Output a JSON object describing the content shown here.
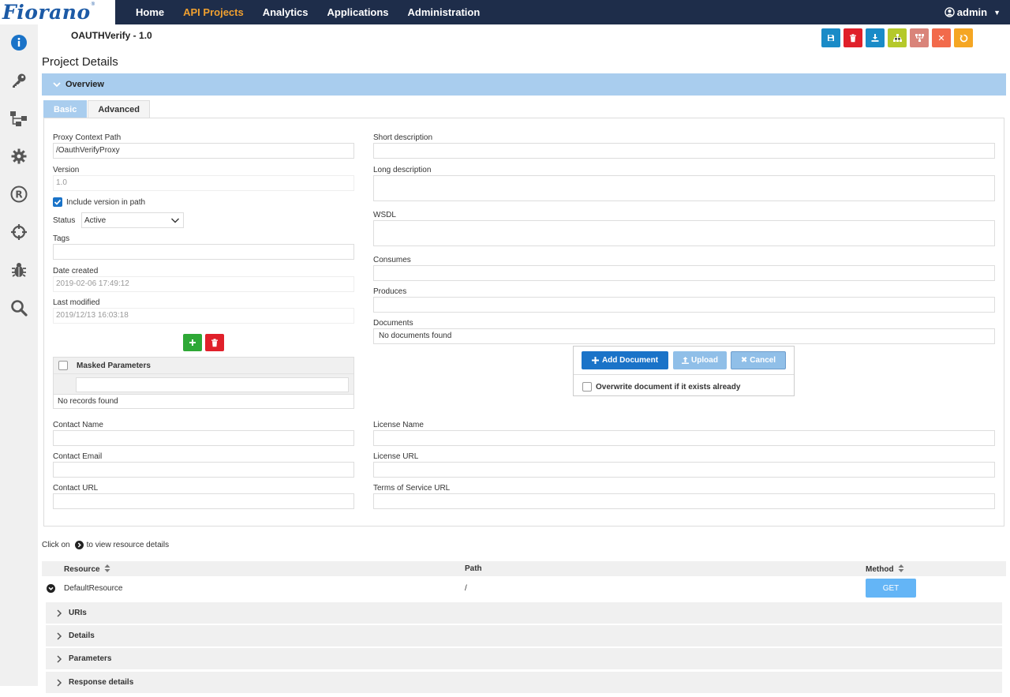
{
  "header": {
    "logo_text": "Fiorano",
    "nav": [
      "Home",
      "API Projects",
      "Analytics",
      "Applications",
      "Administration"
    ],
    "active_nav": "API Projects",
    "user": "admin"
  },
  "sidebar": {
    "icons": [
      "info-icon",
      "key-icon",
      "flow-icon",
      "gear-icon",
      "registered-icon",
      "crosshair-icon",
      "bug-icon",
      "search-icon"
    ]
  },
  "project": {
    "title": "OAUTHVerify - 1.0",
    "page_title": "Project Details"
  },
  "toolbar": {
    "buttons": [
      {
        "name": "save",
        "color": "#1a8bc7"
      },
      {
        "name": "delete",
        "color": "#e0202a"
      },
      {
        "name": "download",
        "color": "#1a8bc7"
      },
      {
        "name": "hierarchy",
        "color": "#b5c92a"
      },
      {
        "name": "tree",
        "color": "#d9847a"
      },
      {
        "name": "close",
        "color": "#f26a4b"
      },
      {
        "name": "refresh",
        "color": "#f5a623"
      }
    ]
  },
  "overview": {
    "label": "Overview",
    "tabs": [
      "Basic",
      "Advanced"
    ],
    "active_tab": "Basic"
  },
  "form": {
    "proxy_context_path_label": "Proxy Context Path",
    "proxy_context_path_value": "/OauthVerifyProxy",
    "version_label": "Version",
    "version_value": "1.0",
    "include_version_label": "Include version in path",
    "include_version_checked": true,
    "status_label": "Status",
    "status_value": "Active",
    "tags_label": "Tags",
    "date_created_label": "Date created",
    "date_created_value": "2019-02-06 17:49:12",
    "last_modified_label": "Last modified",
    "last_modified_value": "2019/12/13 16:03:18",
    "masked_params_label": "Masked Parameters",
    "masked_params_empty": "No records found",
    "short_desc_label": "Short description",
    "long_desc_label": "Long description",
    "wsdl_label": "WSDL",
    "consumes_label": "Consumes",
    "produces_label": "Produces",
    "documents_label": "Documents",
    "documents_empty": "No documents found",
    "contact_name_label": "Contact Name",
    "contact_email_label": "Contact Email",
    "contact_url_label": "Contact URL",
    "license_name_label": "License Name",
    "license_url_label": "License URL",
    "tos_url_label": "Terms of Service URL"
  },
  "doc_popup": {
    "add_label": "Add Document",
    "upload_label": "Upload",
    "cancel_label": "Cancel",
    "overwrite_label": "Overwrite document if it exists already"
  },
  "resources": {
    "hint_before": "Click on",
    "hint_after": "to view resource details",
    "columns": [
      "Resource",
      "Path",
      "Method"
    ],
    "rows": [
      {
        "resource": "DefaultResource",
        "path": "/",
        "method": "GET"
      }
    ],
    "sections": [
      "URIs",
      "Details",
      "Parameters",
      "Response details"
    ]
  }
}
